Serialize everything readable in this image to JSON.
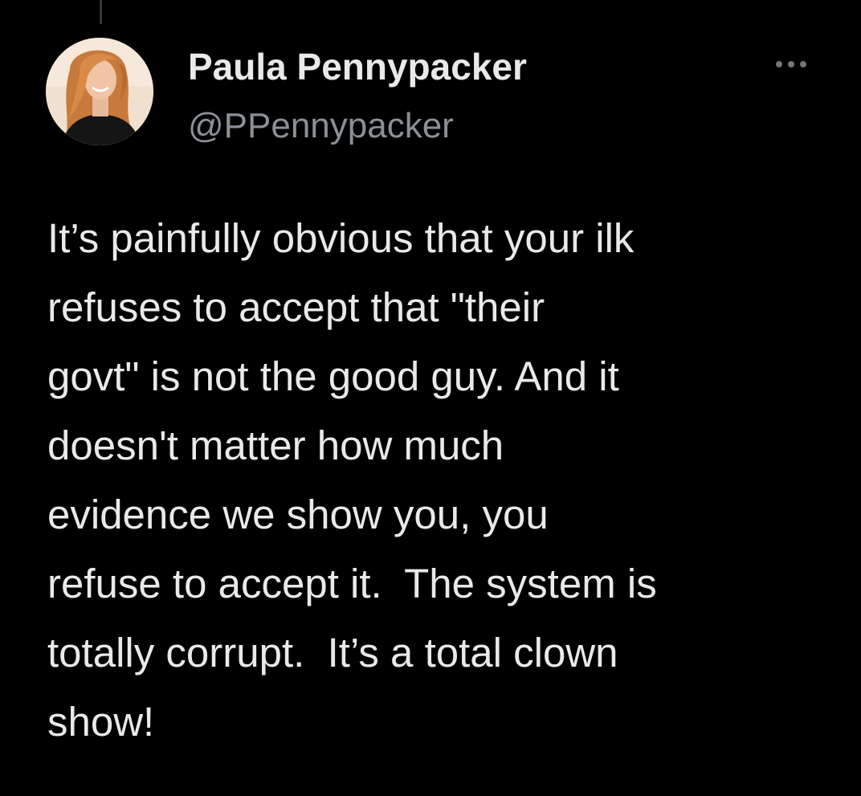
{
  "tweet": {
    "author": {
      "display_name": "Paula Pennypacker",
      "handle": "@PPennypacker",
      "avatar_icon": "profile-photo"
    },
    "more_icon": "more-options-icon",
    "text_lines": [
      "It’s painfully obvious that your ilk",
      "refuses to accept that \"their",
      "govt\" is not the good guy. And it",
      "doesn't matter how much",
      "evidence we show you, you",
      "refuse to accept it.  The system is",
      "totally corrupt.  It’s a total clown",
      "show!"
    ]
  },
  "colors": {
    "background": "#000000",
    "primary_text": "#e7e9ea",
    "secondary_text": "#8b9096",
    "icon": "#71767b"
  }
}
